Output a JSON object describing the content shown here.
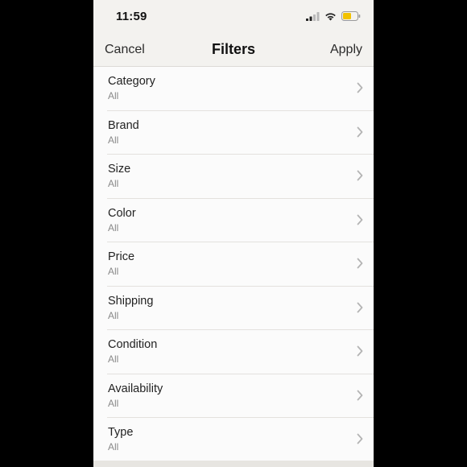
{
  "status_bar": {
    "time": "11:59",
    "battery_color": "#f2c200"
  },
  "nav": {
    "cancel_label": "Cancel",
    "title": "Filters",
    "apply_label": "Apply"
  },
  "filters": [
    {
      "label": "Category",
      "value": "All"
    },
    {
      "label": "Brand",
      "value": "All"
    },
    {
      "label": "Size",
      "value": "All"
    },
    {
      "label": "Color",
      "value": "All"
    },
    {
      "label": "Price",
      "value": "All"
    },
    {
      "label": "Shipping",
      "value": "All"
    },
    {
      "label": "Condition",
      "value": "All"
    },
    {
      "label": "Availability",
      "value": "All"
    },
    {
      "label": "Type",
      "value": "All"
    }
  ],
  "icons": {
    "row_chevron": "chevron-right-icon",
    "signal": "cellular-signal-icon",
    "wifi": "wifi-icon",
    "battery": "battery-icon"
  }
}
